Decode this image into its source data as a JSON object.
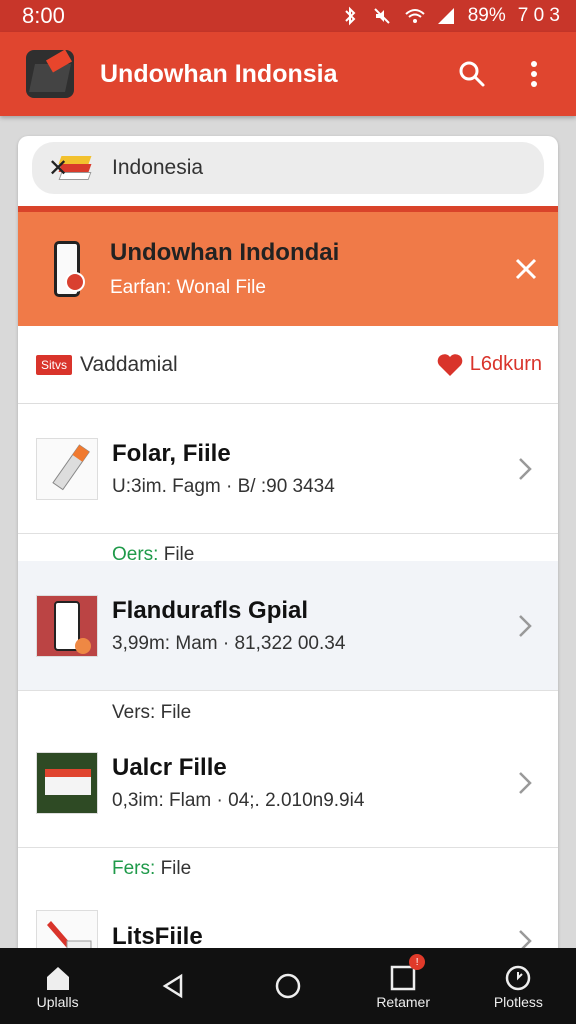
{
  "status": {
    "time": "8:00",
    "battery": "89%",
    "extra": "7 0 3"
  },
  "appbar": {
    "title": "Undowhan Indonsia"
  },
  "search": {
    "value": "Indonesia"
  },
  "banner": {
    "title": "Undowhan Indondai",
    "subtitle": "Earfan: Wonal File"
  },
  "filter": {
    "tag": "Sitvs",
    "label": "Vaddamial",
    "favorite": "L6dkurn"
  },
  "items": [
    {
      "title": "Folar, Fiile",
      "subtitle": "U:3im. Fagm · B/ :90 3434"
    },
    {
      "title": "Flandurafls Gpial",
      "subtitle": "3,99m: Mam · 81,322 00.34"
    },
    {
      "title": "Ualcr Fille",
      "subtitle": "0,3im: Flam · 04;. 2.010n9.9i4"
    },
    {
      "title": "LitsFiile",
      "subtitle": ""
    }
  ],
  "sections": [
    {
      "prefix": "Oers:",
      "label": "File"
    },
    {
      "prefix": "Vers:",
      "label": "File"
    },
    {
      "prefix": "Fers:",
      "label": "File"
    }
  ],
  "nav": {
    "uplalls": "Uplalls",
    "reiamer": "Retamer",
    "badge": "!",
    "plotless": "Plotless"
  },
  "colors": {
    "status_bar": "#c8362a",
    "app_bar": "#e0452f",
    "banner": "#f07a48",
    "accent_green": "#1f9a4a"
  }
}
